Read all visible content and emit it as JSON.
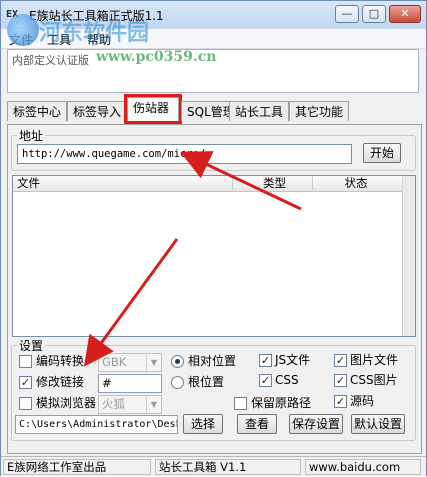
{
  "window": {
    "app_icon": "EX",
    "title": "E族站长工具箱正式版1.1",
    "min_symbol": "—",
    "max_symbol": "□",
    "close_symbol": "✕"
  },
  "watermark": {
    "text": "河东软件园",
    "url": "www.pc0359.cn"
  },
  "menu": {
    "items": [
      "文件",
      "工具",
      "帮助"
    ]
  },
  "notice": {
    "text": "内部定义认证版"
  },
  "tabs": {
    "items": [
      "标签中心",
      "标签导入",
      "伤站器",
      "SQL管理",
      "站长工具",
      "其它功能"
    ],
    "active": 2
  },
  "address": {
    "legend": "地址",
    "url_value": "http://www.quegame.com/micro/",
    "start_label": "开始"
  },
  "filelist": {
    "columns": [
      "文件",
      "类型",
      "状态"
    ]
  },
  "settings": {
    "legend": "设置",
    "encoding": {
      "label": "编码转换",
      "checked": false,
      "value": "GBK"
    },
    "modify_links": {
      "label": "修改链接",
      "checked": true,
      "value": "#"
    },
    "simulate_browser": {
      "label": "模拟浏览器",
      "checked": false,
      "value": "火狐"
    },
    "relative_pos": {
      "label": "相对位置",
      "selected": true
    },
    "root_pos": {
      "label": "根位置",
      "selected": false
    },
    "keep_path": {
      "label": "保留原路径",
      "checked": false
    },
    "js_files": {
      "label": "JS文件",
      "checked": true
    },
    "css": {
      "label": "CSS",
      "checked": true
    },
    "image_files": {
      "label": "图片文件",
      "checked": true
    },
    "css_images": {
      "label": "CSS图片",
      "checked": true
    },
    "source": {
      "label": "源码",
      "checked": true
    },
    "path_value": "C:\\Users\\Administrator\\Desk",
    "buttons": [
      "选择",
      "查看",
      "保存设置",
      "默认设置"
    ]
  },
  "statusbar": {
    "left": "E族网络工作室出品",
    "middle": "站长工具箱 V1.1",
    "right": "www.baidu.com"
  },
  "colors": {
    "highlight": "#d81d1d",
    "watermark": "#288cd2",
    "watermark_url": "#3ca050"
  }
}
